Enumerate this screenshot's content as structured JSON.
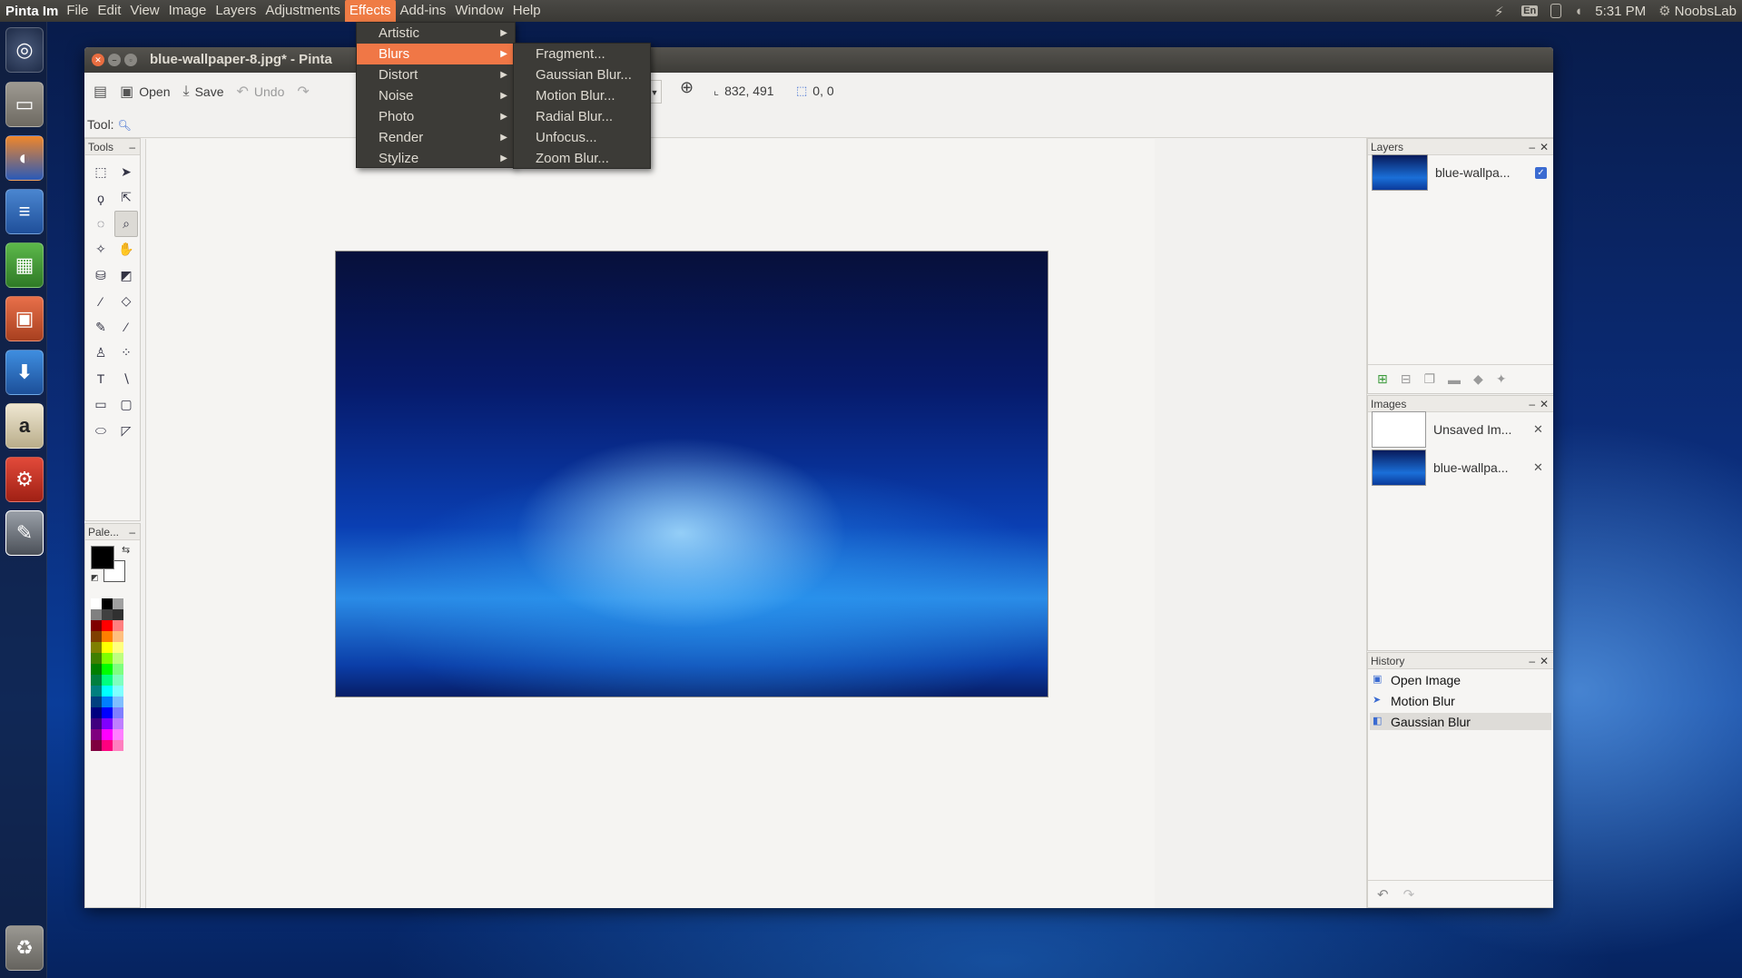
{
  "panel": {
    "app_name": "Pinta Im",
    "menus": [
      "File",
      "Edit",
      "View",
      "Image",
      "Layers",
      "Adjustments",
      "Effects",
      "Add-ins",
      "Window",
      "Help"
    ],
    "active_menu": "Effects",
    "keyboard": "En",
    "time": "5:31 PM",
    "user": "NoobsLab"
  },
  "window": {
    "title": "blue-wallpaper-8.jpg* - Pinta"
  },
  "toolbar": {
    "open": "Open",
    "save": "Save",
    "undo": "Undo",
    "cursor_pos": "832, 491",
    "selection_size": "0, 0"
  },
  "tool_label": "Tool:",
  "tools_panel": {
    "title": "Tools",
    "min": "–"
  },
  "palette_panel": {
    "title": "Pale...",
    "min": "–"
  },
  "layers_panel": {
    "title": "Layers",
    "layers": [
      {
        "name": "blue-wallpa...",
        "visible": true
      }
    ]
  },
  "images_panel": {
    "title": "Images",
    "images": [
      {
        "name": "Unsaved Im..."
      },
      {
        "name": "blue-wallpa..."
      }
    ]
  },
  "history_panel": {
    "title": "History",
    "items": [
      {
        "label": "Open Image"
      },
      {
        "label": "Motion Blur"
      },
      {
        "label": "Gaussian Blur",
        "selected": true
      }
    ]
  },
  "effects_menu": {
    "items": [
      "Artistic",
      "Blurs",
      "Distort",
      "Noise",
      "Photo",
      "Render",
      "Stylize"
    ],
    "highlighted": "Blurs"
  },
  "blurs_submenu": {
    "items": [
      "Fragment...",
      "Gaussian Blur...",
      "Motion Blur...",
      "Radial Blur...",
      "Unfocus...",
      "Zoom Blur..."
    ]
  },
  "colors": {
    "accent": "#f07746",
    "panel_bg": "#3c3b37",
    "primary_color": "#000000",
    "secondary_color": "#ffffff"
  }
}
